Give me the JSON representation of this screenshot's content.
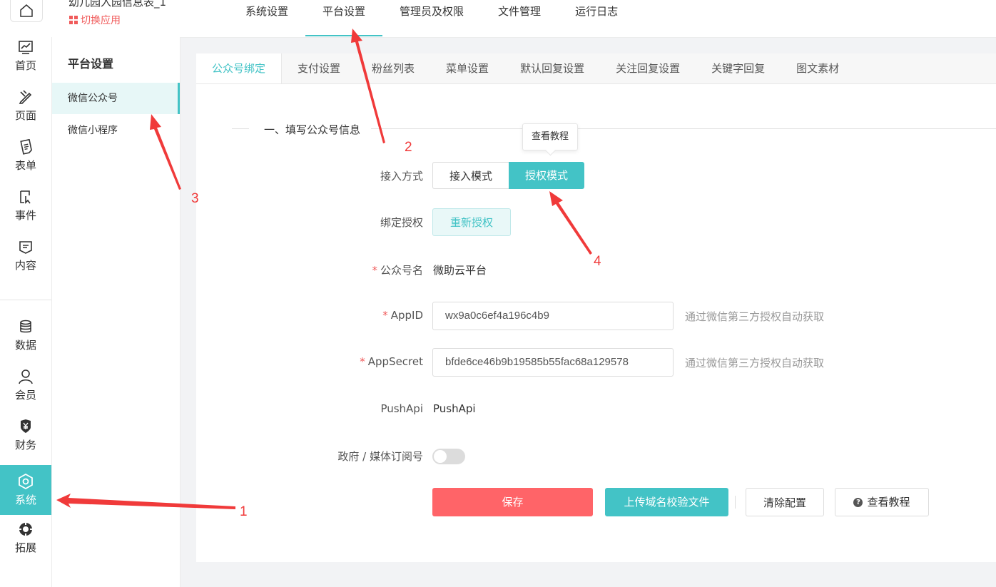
{
  "header": {
    "app_name": "幼儿园入园信息表_1",
    "switch_app": "切换应用",
    "nav": [
      "系统设置",
      "平台设置",
      "管理员及权限",
      "文件管理",
      "运行日志"
    ]
  },
  "rail": {
    "items": [
      {
        "label": "首页",
        "icon": "chart-icon"
      },
      {
        "label": "页面",
        "icon": "page-edit-icon"
      },
      {
        "label": "表单",
        "icon": "form-icon"
      },
      {
        "label": "事件",
        "icon": "event-icon"
      },
      {
        "label": "内容",
        "icon": "content-icon"
      },
      {
        "label": "数据",
        "icon": "database-icon"
      },
      {
        "label": "会员",
        "icon": "user-icon"
      },
      {
        "label": "财务",
        "icon": "yen-shield-icon"
      },
      {
        "label": "系统",
        "icon": "settings-hex-icon"
      },
      {
        "label": "拓展",
        "icon": "extend-icon"
      }
    ]
  },
  "sidebar": {
    "title": "平台设置",
    "items": [
      "微信公众号",
      "微信小程序"
    ]
  },
  "tabs": [
    "公众号绑定",
    "支付设置",
    "粉丝列表",
    "菜单设置",
    "默认回复设置",
    "关注回复设置",
    "关键字回复",
    "图文素材"
  ],
  "form": {
    "section_title": "一、填写公众号信息",
    "tooltip": "查看教程",
    "access_label": "接入方式",
    "access_options": [
      "接入模式",
      "授权模式"
    ],
    "access_selected": "授权模式",
    "bind_label": "绑定授权",
    "reauth_button": "重新授权",
    "name_label": "公众号名",
    "name_value": "微助云平台",
    "appid_label": "AppID",
    "appid_value": "wx9a0c6ef4a196c4b9",
    "appid_hint": "通过微信第三方授权自动获取",
    "secret_label": "AppSecret",
    "secret_value": "bfde6ce46b9b19585b55fac68a129578",
    "secret_hint": "通过微信第三方授权自动获取",
    "pushapi_label": "PushApi",
    "pushapi_value": "PushApi",
    "gov_label": "政府 / 媒体订阅号",
    "gov_enabled": false,
    "required_mark": "*"
  },
  "buttons": {
    "save": "保存",
    "upload": "上传域名校验文件",
    "clear": "清除配置",
    "tutorial": "查看教程"
  },
  "annotations": [
    "1",
    "2",
    "3",
    "4"
  ],
  "colors": {
    "accent": "#43c3c6",
    "danger": "#ff6468",
    "annotation": "#f03a3a"
  }
}
